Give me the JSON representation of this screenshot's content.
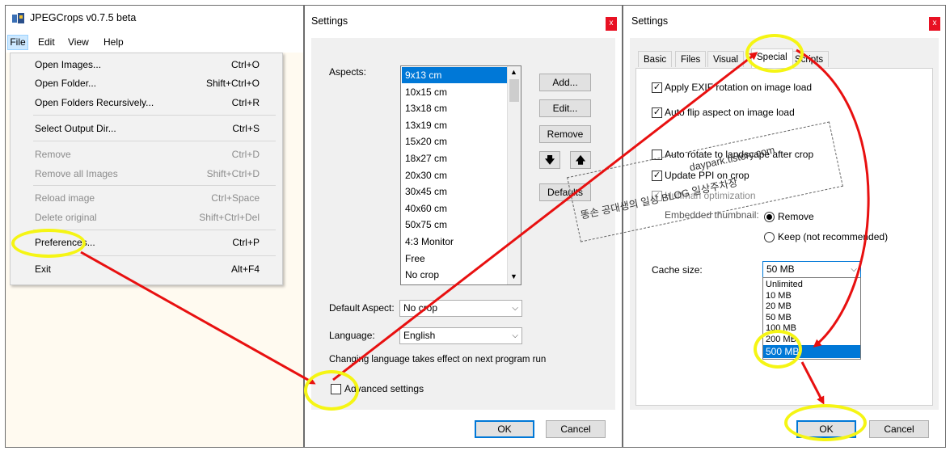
{
  "panel1": {
    "app_title": "JPEGCrops v0.7.5 beta",
    "menubar": [
      "File",
      "Edit",
      "View",
      "Help"
    ],
    "menu_items": [
      {
        "label": "Open Images...",
        "shortcut": "Ctrl+O",
        "enabled": true
      },
      {
        "label": "Open Folder...",
        "shortcut": "Shift+Ctrl+O",
        "enabled": true
      },
      {
        "label": "Open Folders Recursively...",
        "shortcut": "Ctrl+R",
        "enabled": true
      },
      {
        "label": "Select Output Dir...",
        "shortcut": "Ctrl+S",
        "enabled": true
      },
      {
        "label": "Remove",
        "shortcut": "Ctrl+D",
        "enabled": false
      },
      {
        "label": "Remove all Images",
        "shortcut": "Shift+Ctrl+D",
        "enabled": false
      },
      {
        "label": "Reload image",
        "shortcut": "Ctrl+Space",
        "enabled": false
      },
      {
        "label": "Delete original",
        "shortcut": "Shift+Ctrl+Del",
        "enabled": false
      },
      {
        "label": "Preferences...",
        "shortcut": "Ctrl+P",
        "enabled": true
      },
      {
        "label": "Exit",
        "shortcut": "Alt+F4",
        "enabled": true
      }
    ]
  },
  "panel2": {
    "title": "Settings",
    "close": "x",
    "aspects_label": "Aspects:",
    "aspects": [
      "9x13 cm",
      "10x15 cm",
      "13x18 cm",
      "13x19 cm",
      "15x20 cm",
      "18x27 cm",
      "20x30 cm",
      "30x45 cm",
      "40x60 cm",
      "50x75 cm",
      "4:3 Monitor",
      "Free",
      "No crop"
    ],
    "buttons": {
      "add": "Add...",
      "edit": "Edit...",
      "remove": "Remove",
      "down": "🡇",
      "up": "🡅",
      "defaults": "Defaults"
    },
    "default_aspect_label": "Default Aspect:",
    "default_aspect_value": "No crop",
    "language_label": "Language:",
    "language_value": "English",
    "language_note": "Changing language takes effect on next program run",
    "advanced_label": "Advanced settings",
    "ok": "OK",
    "cancel": "Cancel"
  },
  "panel3": {
    "title": "Settings",
    "close": "x",
    "tabs": [
      "Basic",
      "Files",
      "Visual",
      "Special",
      "Scripts"
    ],
    "active_tab": "Special",
    "options": {
      "exif": "Apply EXIF rotation on image load",
      "autoflip": "Auto flip aspect on image load",
      "autorotate": "Auto rotate to landscape after crop",
      "ppi": "Update PPI on crop",
      "huffman": "Huffman optimization",
      "thumbnail_label": "Embedded thumbnail:",
      "remove": "Remove",
      "keep": "Keep (not recommended)"
    },
    "cache_label": "Cache size:",
    "cache_value": "50 MB",
    "cache_options": [
      "Unlimited",
      "10 MB",
      "20 MB",
      "50 MB",
      "100 MB",
      "200 MB",
      "500 MB"
    ],
    "cache_selected": "500 MB",
    "ok": "OK",
    "cancel": "Cancel"
  },
  "watermark": {
    "line1": "daypark.tistory.com",
    "line2": "똥손 공대생의 일상 BLOG 일상주차장"
  },
  "colors": {
    "highlight": "#f5f514",
    "arrow": "#e81010",
    "selection": "#0078d7"
  }
}
